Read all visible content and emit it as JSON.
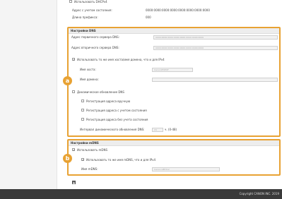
{
  "top_rows": {
    "ipv4_checkbox": "Использовать DHCPv4",
    "stateful_label": "Адрес с учетом состояния:",
    "stateful_value": "0000:0000:0000:0000:0000:0000:0000:0000",
    "prefix_label": "Длина префикса:",
    "prefix_value": "000"
  },
  "dns": {
    "title": "Настройки DNS",
    "primary_label": "Адрес первичного сервера DNS:",
    "primary_value": "0000:0000:0000:0000:0000:0000:0000:0000",
    "secondary_label": "Адрес вторичного сервера DNS:",
    "secondary_value": "0000:0000:0000:0000:0000:0000:0000:0000",
    "same_host_label": "Использовать то же имя хоста/имя домена, что и для IPv4",
    "host_label": "Имя хоста:",
    "host_value": "Canon0F0E0F",
    "domain_label": "Имя домена:",
    "domain_value": "",
    "dyn_update_label": "Динамическое обновление DNS",
    "reg_manual_label": "Регистрация адреса вручную",
    "reg_stateful_label": "Регистрация адреса с учетом состояния",
    "reg_stateless_label": "Регистрация адреса без учета состояния",
    "interval_label": "Интервал динамического обновления DNS:",
    "interval_value": "24",
    "interval_unit": "ч. (0-48)"
  },
  "mdns": {
    "title": "Настройки mDNS",
    "use_label": "Использовать mDNS",
    "same_name_label": "Использовать то же имя mDNS, что и для IPv4",
    "name_label": "Имя mDNS:",
    "name_value": "Canon LBP312"
  },
  "badges": {
    "a": "a",
    "b": "b"
  },
  "footer": {
    "copyright": "Copyright CANON INC. 2019"
  },
  "accent_color": "#e8a233"
}
